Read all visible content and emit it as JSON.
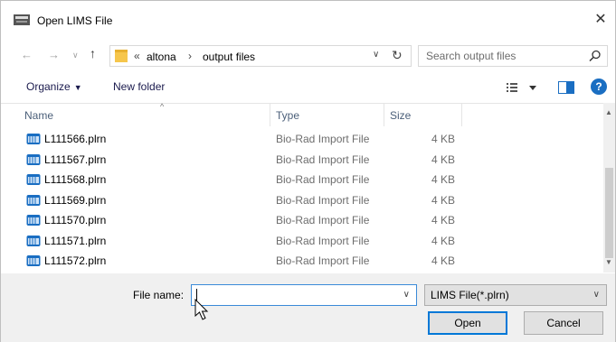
{
  "window": {
    "title": "Open LIMS File",
    "close_symbol": "✕"
  },
  "navigation": {
    "back_icon": "arrow-left-icon",
    "forward_icon": "arrow-right-icon",
    "recent_icon": "chevron-down-icon",
    "up_icon": "arrow-up-icon",
    "breadcrumb_prefix": "«",
    "breadcrumbs": [
      "altona",
      "output files"
    ],
    "breadcrumb_separator": "›"
  },
  "search": {
    "placeholder": "Search output files"
  },
  "toolbar": {
    "organize_label": "Organize",
    "new_folder_label": "New folder",
    "help_label": "?"
  },
  "columns": {
    "name": "Name",
    "type": "Type",
    "size": "Size"
  },
  "files": [
    {
      "name": "L111566.plrn",
      "type": "Bio-Rad Import File",
      "size": "4 KB"
    },
    {
      "name": "L111567.plrn",
      "type": "Bio-Rad Import File",
      "size": "4 KB"
    },
    {
      "name": "L111568.plrn",
      "type": "Bio-Rad Import File",
      "size": "4 KB"
    },
    {
      "name": "L111569.plrn",
      "type": "Bio-Rad Import File",
      "size": "4 KB"
    },
    {
      "name": "L111570.plrn",
      "type": "Bio-Rad Import File",
      "size": "4 KB"
    },
    {
      "name": "L111571.plrn",
      "type": "Bio-Rad Import File",
      "size": "4 KB"
    },
    {
      "name": "L111572.plrn",
      "type": "Bio-Rad Import File",
      "size": "4 KB"
    }
  ],
  "footer": {
    "file_name_label": "File name:",
    "file_name_value": "",
    "file_type_selected": "LIMS File(*.plrn)",
    "open_label": "Open",
    "cancel_label": "Cancel"
  },
  "colors": {
    "accent": "#0078d7",
    "folder": "#f6c64c",
    "file_icon": "#1a6ec2",
    "help": "#1a6ec2"
  }
}
